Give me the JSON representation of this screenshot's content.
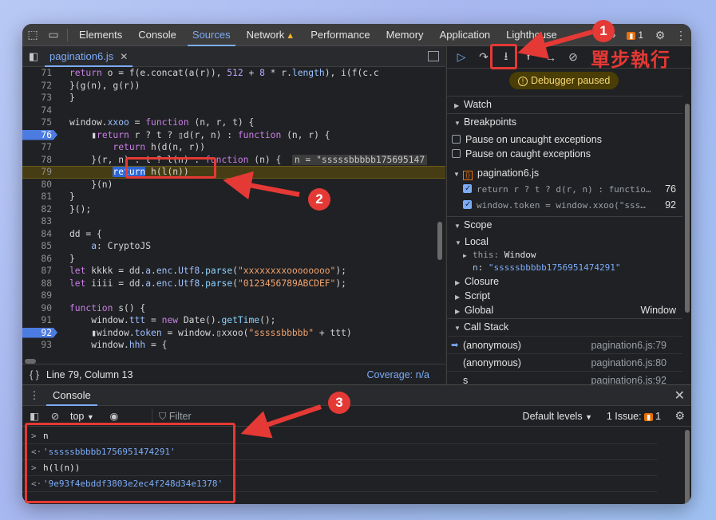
{
  "topbar": {
    "tabs": [
      "Elements",
      "Console",
      "Sources",
      "Network",
      "Performance",
      "Memory",
      "Application",
      "Lighthouse"
    ],
    "active_tab": "Sources",
    "more_label": "»",
    "issues_count": "1"
  },
  "editor": {
    "file_tab": "pagination6.js",
    "lines": [
      {
        "n": "71",
        "html": "<span class='kw'>return</span> o = f(e.concat(a(r)), <span class='num'>512</span> + <span class='num'>8</span> * r.<span class='prop'>length</span>), i(f(c.c"
      },
      {
        "n": "72",
        "html": "}(g(n), g(r))"
      },
      {
        "n": "73",
        "html": "}"
      },
      {
        "n": "74",
        "html": ""
      },
      {
        "n": "75",
        "html": "window.<span class='prop'>xxoo</span> = <span class='kw'>function</span> (n, r, t) {"
      },
      {
        "n": "76",
        "html": "    ▮<span class='kw'>return</span> r ? t ? ▯d(r, n) : <span class='kw'>function</span> (n, r) {"
      },
      {
        "n": "77",
        "html": "        <span class='kw'>return</span> h(d(n, r))"
      },
      {
        "n": "78",
        "html": "    }(r, n) : t ? l(n) : <span class='kw'>function</span> (n) {  <span class='inlineval'>n = \"sssssbbbbb175695147</span>"
      },
      {
        "n": "79",
        "html": "        <span class='sel'>return</span> h(l(n))"
      },
      {
        "n": "80",
        "html": "    }(n)"
      },
      {
        "n": "81",
        "html": "}"
      },
      {
        "n": "82",
        "html": "}();"
      },
      {
        "n": "83",
        "html": ""
      },
      {
        "n": "84",
        "html": "dd = {"
      },
      {
        "n": "85",
        "html": "    <span class='prop'>a</span>: CryptoJS"
      },
      {
        "n": "86",
        "html": "}"
      },
      {
        "n": "87",
        "html": "<span class='kw'>let</span> kkkk = dd.<span class='prop'>a</span>.<span class='prop'>enc</span>.<span class='prop'>Utf8</span>.<span class='fn'>parse</span>(<span class='str'>\"xxxxxxxxoooooooo\"</span>);"
      },
      {
        "n": "88",
        "html": "<span class='kw'>let</span> iiii = dd.<span class='prop'>a</span>.<span class='prop'>enc</span>.<span class='prop'>Utf8</span>.<span class='fn'>parse</span>(<span class='str'>\"0123456789ABCDEF\"</span>);"
      },
      {
        "n": "89",
        "html": ""
      },
      {
        "n": "90",
        "html": "<span class='kw'>function</span> s() {"
      },
      {
        "n": "91",
        "html": "    window.<span class='prop'>ttt</span> = <span class='kw'>new</span> Date().<span class='fn'>getTime</span>();"
      },
      {
        "n": "92",
        "html": "    ▮window.<span class='prop'>token</span> = window.▯xxoo(<span class='str'>\"sssssbbbbb\"</span> + ttt)"
      },
      {
        "n": "93",
        "html": "    window.<span class='prop'>hhh</span> = {"
      }
    ],
    "status_position": "Line 79, Column 13",
    "coverage": "Coverage: n/a"
  },
  "debugger": {
    "paused_label": "Debugger paused",
    "sections": {
      "watch": "Watch",
      "breakpoints": "Breakpoints",
      "scope": "Scope",
      "call_stack": "Call Stack"
    },
    "pause_uncaught": "Pause on uncaught exceptions",
    "pause_caught": "Pause on caught exceptions",
    "bp_file": "pagination6.js",
    "bp_items": [
      {
        "code": "return r ? t ? d(r, n) : functio…",
        "line": "76"
      },
      {
        "code": "window.token = window.xxoo(\"sss…",
        "line": "92"
      }
    ],
    "scope": {
      "local": "Local",
      "this_key": "this",
      "this_val": "Window",
      "n_key": "n",
      "n_val": "\"sssssbbbbb1756951474291\"",
      "closure": "Closure",
      "script": "Script",
      "global": "Global",
      "global_val": "Window"
    },
    "stack": [
      {
        "name": "(anonymous)",
        "loc": "pagination6.js:79"
      },
      {
        "name": "(anonymous)",
        "loc": "pagination6.js:80"
      },
      {
        "name": "s",
        "loc": "pagination6.js:92"
      }
    ]
  },
  "console": {
    "tab": "Console",
    "context": "top",
    "filter_placeholder": "Filter",
    "levels": "Default levels",
    "issue_label": "1 Issue:",
    "issue_count": "1",
    "lines": [
      {
        "prefix": ">",
        "text": "n",
        "type": "input"
      },
      {
        "prefix": "<·",
        "text": "'sssssbbbbb1756951474291'",
        "type": "result"
      },
      {
        "prefix": ">",
        "text": "h(l(n))",
        "type": "input"
      },
      {
        "prefix": "<·",
        "text": "'9e93f4ebddf3803e2ec4f248d34e1378'",
        "type": "result"
      }
    ]
  },
  "annotations": {
    "step1": "1",
    "step2": "2",
    "step3": "3",
    "step_label": "單步執行",
    "color": "#e53935"
  }
}
